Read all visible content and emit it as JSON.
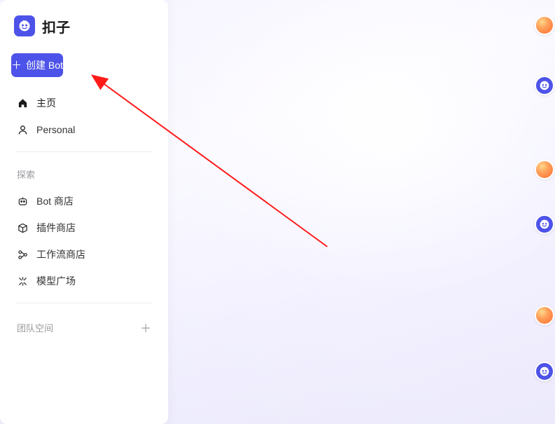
{
  "brand": {
    "name": "扣子"
  },
  "create_button": {
    "label": "创建 Bot"
  },
  "nav": {
    "home_label": "主页",
    "personal_label": "Personal"
  },
  "sections": {
    "explore": {
      "title": "探索",
      "items": {
        "bot_store": "Bot 商店",
        "plugin_store": "插件商店",
        "workflow_store": "工作流商店",
        "model_square": "模型广场"
      }
    },
    "team_space": {
      "title": "团队空间"
    }
  }
}
